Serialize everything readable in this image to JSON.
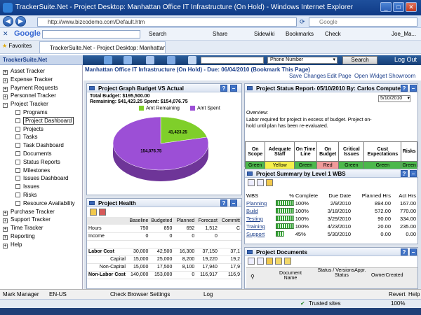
{
  "window": {
    "title": "TrackerSuite.Net - Project Desktop: Manhattan Office IT Infrastructure (On Hold) - Windows Internet Explorer"
  },
  "browser": {
    "url": "http://www.bizcodemo.com/Default.htm",
    "search_engine": "Google",
    "google_bar": {
      "search_label": "Search",
      "share_label": "Share",
      "sidewiki_label": "Sidewiki",
      "bookmarks_label": "Bookmarks",
      "check_label": "Check",
      "user_label": "Joe_Ma..."
    },
    "favorites_label": "Favorites",
    "tab_title": "TrackerSuite.Net - Project Desktop: Manhattan Office ..."
  },
  "app": {
    "site_name": "TrackerSuite.Net",
    "phone_select": "Phone Number",
    "search_button": "Search",
    "logout": "Log Out"
  },
  "sidebar": {
    "items": [
      {
        "label": "Asset Tracker",
        "box": "+"
      },
      {
        "label": "Expense Tracker",
        "box": "+"
      },
      {
        "label": "Payment Requests",
        "box": "+"
      },
      {
        "label": "Personnel Tracker",
        "box": "+"
      },
      {
        "label": "Project Tracker",
        "box": "-"
      },
      {
        "label": "Programs",
        "box": ""
      },
      {
        "label": "Project Dashboard",
        "box": ""
      },
      {
        "label": "Projects",
        "box": ""
      },
      {
        "label": "Tasks",
        "box": ""
      },
      {
        "label": "Task Dashboard",
        "box": ""
      },
      {
        "label": "Documents",
        "box": ""
      },
      {
        "label": "Status Reports",
        "box": ""
      },
      {
        "label": "Milestones",
        "box": ""
      },
      {
        "label": "Issues Dashboard",
        "box": ""
      },
      {
        "label": "Issues",
        "box": ""
      },
      {
        "label": "Risks",
        "box": ""
      },
      {
        "label": "Resource Availability",
        "box": ""
      },
      {
        "label": "Purchase Tracker",
        "box": "+"
      },
      {
        "label": "Support Tracker",
        "box": "+"
      },
      {
        "label": "Time Tracker",
        "box": "+"
      },
      {
        "label": "Reporting",
        "box": "+"
      },
      {
        "label": "Help",
        "box": "+"
      }
    ]
  },
  "page": {
    "title": "Manhattan Office IT Infrastructure (On Hold) - Due: 06/04/2010 (Bookmark This Page)",
    "links": [
      "Save Changes",
      "Edit Page",
      "Open Widget Showroom"
    ]
  },
  "budget_panel": {
    "title": "Project Graph Budget VS Actual",
    "total": "Total Budget: $195,500.00",
    "remaining": "Remaining: $41,423.25 Spent: $154,076.75",
    "legend_remaining": "Amt Remaining",
    "legend_spent": "Amt Spent",
    "label_remaining": "41,423.25",
    "label_spent": "154,076.75",
    "colors": {
      "remaining": "#7fcf2a",
      "spent": "#9c4fd6"
    }
  },
  "chart_data": {
    "type": "pie",
    "categories": [
      "Amt Remaining",
      "Amt Spent"
    ],
    "values": [
      41423.25,
      154076.75
    ]
  },
  "health_panel": {
    "title": "Project Health",
    "columns": [
      "",
      "Baseline",
      "Budgeted",
      "Planned",
      "Forecast",
      "Committ"
    ],
    "rows": [
      [
        "Hours",
        "750",
        "850",
        "692",
        "1,512",
        "C"
      ],
      [
        "Income",
        "0",
        "0",
        "0",
        "0",
        ""
      ],
      [
        "",
        "",
        "",
        "",
        "",
        ""
      ],
      [
        "Labor Cost",
        "30,000",
        "42,500",
        "16,300",
        "37,150",
        "37,1"
      ],
      [
        "Capital",
        "15,000",
        "25,000",
        "8,200",
        "19,220",
        "19,2"
      ],
      [
        "Non-Capital",
        "15,000",
        "17,500",
        "8,100",
        "17,940",
        "17,9"
      ],
      [
        "Non-Labor Cost",
        "140,000",
        "153,000",
        "0",
        "116,917",
        "116,9"
      ]
    ]
  },
  "status_panel": {
    "title": "Project Status Report- 05/10/2010 By: Carlos Computer",
    "date_select": "5/10/2010",
    "overview_label": "Overview:",
    "overview_text": "Labor required for project in excess of budget. Project on-hold until plan has been re-evaluated.",
    "headers": [
      "On Scope",
      "Adequate Staff",
      "On Time Line",
      "On Budget",
      "Critical Issues",
      "Cust Expectations",
      "Risks"
    ],
    "values": [
      "Green",
      "Yellow",
      "Green",
      "Red",
      "Green",
      "Green",
      "Green"
    ],
    "colors": {
      "Green": "#4cb84c",
      "Yellow": "#f5ef4a",
      "Red": "#f19a9a"
    }
  },
  "wbs_panel": {
    "title": "Project Summary by Level 1 WBS",
    "columns": [
      "WBS",
      "% Complete",
      "Due Date",
      "Planned Hrs",
      "Act Hrs"
    ],
    "rows": [
      {
        "wbs": "Planning",
        "pct": "100%",
        "fill": 1.0,
        "due": "2/9/2010",
        "planned": "894.00",
        "act": "167.00"
      },
      {
        "wbs": "Build",
        "pct": "100%",
        "fill": 1.0,
        "due": "3/18/2010",
        "planned": "572.00",
        "act": "770.00"
      },
      {
        "wbs": "Testing",
        "pct": "100%",
        "fill": 1.0,
        "due": "3/29/2010",
        "planned": "90.00",
        "act": "334.00"
      },
      {
        "wbs": "Training",
        "pct": "100%",
        "fill": 1.0,
        "due": "4/23/2010",
        "planned": "20.00",
        "act": "235.00"
      },
      {
        "wbs": "Support",
        "pct": "45%",
        "fill": 0.45,
        "due": "5/30/2010",
        "planned": "0.00",
        "act": "0.00"
      }
    ]
  },
  "docs_panel": {
    "title": "Project Documents",
    "columns": [
      "Document Name",
      "Status / VersionsAppr. Status",
      "OwnerCreated"
    ]
  },
  "statusbar": {
    "left": "Mark Manager",
    "locale": "EN-US",
    "check": "Check Browser Settings",
    "log": "Log",
    "revert": "Revert",
    "help": "Help",
    "zone": "Trusted sites",
    "zoom": "100%"
  }
}
